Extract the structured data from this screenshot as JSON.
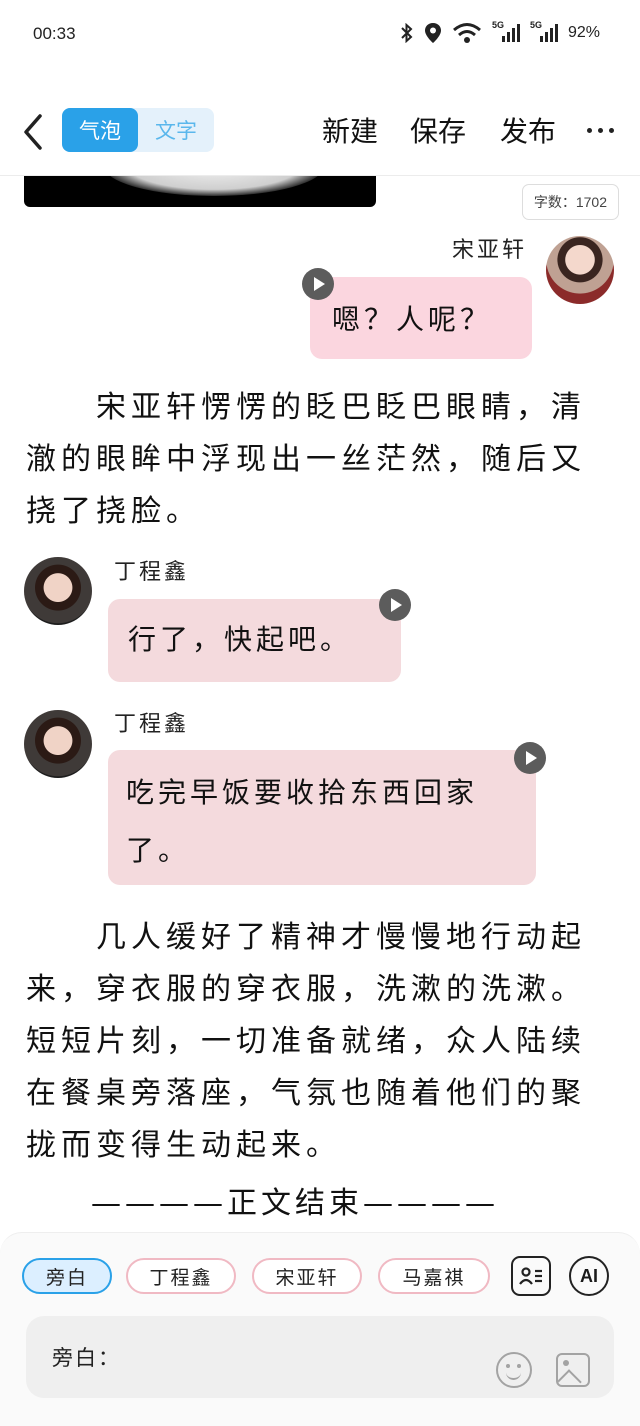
{
  "status_bar": {
    "time": "00:33",
    "network_label_1": "5G",
    "network_label_2": "5G",
    "battery": "92%"
  },
  "header": {
    "mode_bubble": "气泡",
    "mode_text": "文字",
    "new_label": "新建",
    "save_label": "保存",
    "publish_label": "发布"
  },
  "word_count": "字数：1702",
  "messages": [
    {
      "speaker": "宋亚轩",
      "text": "嗯？人呢？"
    },
    {
      "speaker": "丁程鑫",
      "text": "行了，快起吧。"
    },
    {
      "speaker": "丁程鑫",
      "text": "吃完早饭要收拾东西回家了。"
    }
  ],
  "paragraphs": [
    "　　宋亚轩愣愣的眨巴眨巴眼睛，清澈的眼眸中浮现出一丝茫然，随后又挠了挠脸。",
    "　　几人缓好了精神才慢慢地行动起来，穿衣服的穿衣服，洗漱的洗漱。短短片刻，一切准备就绪，众人陆续在餐桌旁落座，气氛也随着他们的聚拢而变得生动起来。"
  ],
  "ending": "————正文结束————",
  "role_chips": [
    "旁白",
    "丁程鑫",
    "宋亚轩",
    "马嘉祺"
  ],
  "ai_label": "AI",
  "input": {
    "prefix": "旁白："
  },
  "colors": {
    "accent": "#2aa1e8",
    "bubble_right": "#fbd6df",
    "bubble_left": "#f4dadd"
  }
}
